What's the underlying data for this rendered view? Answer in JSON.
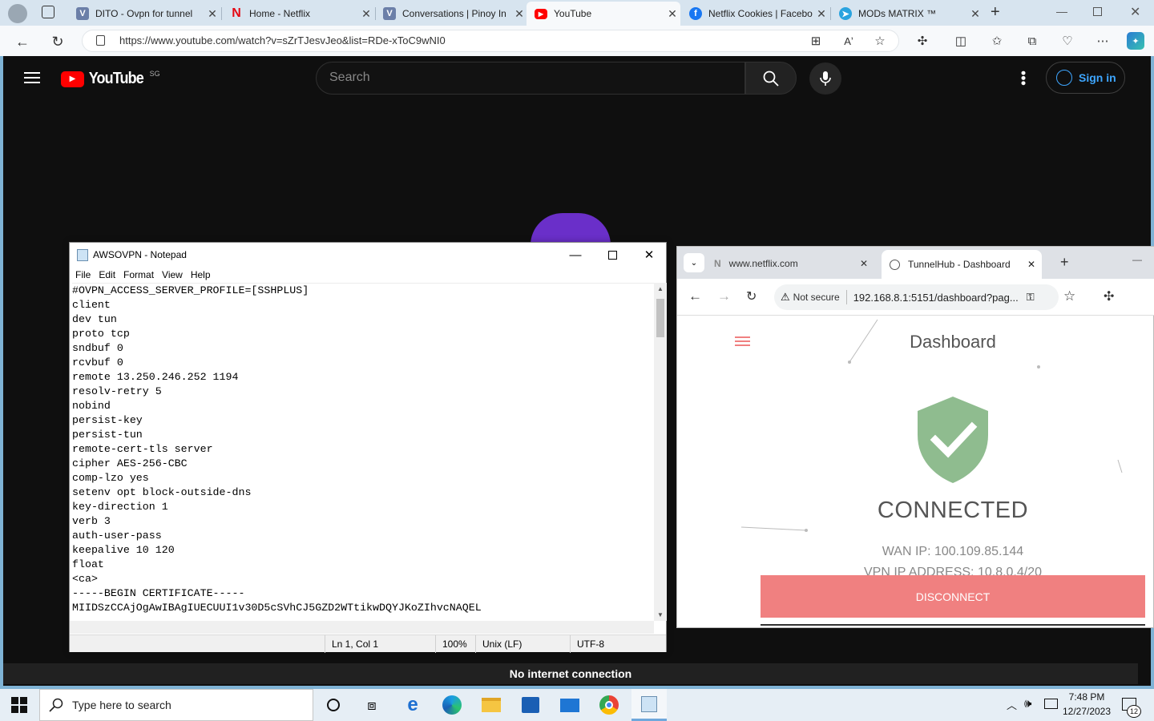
{
  "browser": {
    "tabs": [
      {
        "title": "DITO - Ovpn for tunnel",
        "icon": "shield-icon"
      },
      {
        "title": "Home - Netflix",
        "icon": "netflix-icon"
      },
      {
        "title": "Conversations | Pinoy In",
        "icon": "shield-icon"
      },
      {
        "title": "YouTube",
        "icon": "youtube-icon"
      },
      {
        "title": "Netflix Cookies | Facebo",
        "icon": "facebook-icon"
      },
      {
        "title": "MODs MATRIX ™",
        "icon": "telegram-icon"
      }
    ],
    "url": "https://www.youtube.com/watch?v=sZrTJesvJeo&list=RDe-xToC9wNI0"
  },
  "youtube": {
    "logo_text": "YouTube",
    "region": "SG",
    "search_placeholder": "Search",
    "sign_in": "Sign in",
    "no_connection": "No internet connection"
  },
  "notepad": {
    "title": "AWSOVPN - Notepad",
    "menu": [
      "File",
      "Edit",
      "Format",
      "View",
      "Help"
    ],
    "lines": [
      "#OVPN_ACCESS_SERVER_PROFILE=[SSHPLUS]",
      "client",
      "dev tun",
      "proto tcp",
      "sndbuf 0",
      "rcvbuf 0",
      "remote 13.250.246.252 1194",
      "resolv-retry 5",
      "nobind",
      "persist-key",
      "persist-tun",
      "remote-cert-tls server",
      "cipher AES-256-CBC",
      "comp-lzo yes",
      "setenv opt block-outside-dns",
      "key-direction 1",
      "verb 3",
      "auth-user-pass",
      "keepalive 10 120",
      "float",
      "<ca>",
      "-----BEGIN CERTIFICATE-----",
      "MIIDSzCCAjOgAwIBAgIUECUUI1v30D5cSVhCJ5GZD2WTtikwDQYJKoZIhvcNAQEL"
    ],
    "status": {
      "position": "Ln 1, Col 1",
      "zoom": "100%",
      "eol": "Unix (LF)",
      "encoding": "UTF-8"
    }
  },
  "chrome": {
    "tabs": [
      {
        "title": "www.netflix.com",
        "icon": "netflix-icon"
      },
      {
        "title": "TunnelHub - Dashboard",
        "icon": "globe-icon"
      }
    ],
    "security": "Not secure",
    "url": "192.168.8.1:5151/dashboard?pag...",
    "dashboard": {
      "title": "Dashboard",
      "status": "CONNECTED",
      "wan_ip": "WAN IP: 100.109.85.144",
      "vpn_ip": "VPN IP ADDRESS: 10.8.0.4/20",
      "disconnect": "DISCONNECT",
      "accent": "#f08080",
      "shield_color": "#8fbc8f"
    }
  },
  "taskbar": {
    "search_placeholder": "Type here to search",
    "time": "7:48 PM",
    "date": "12/27/2023",
    "notifications": "12"
  }
}
